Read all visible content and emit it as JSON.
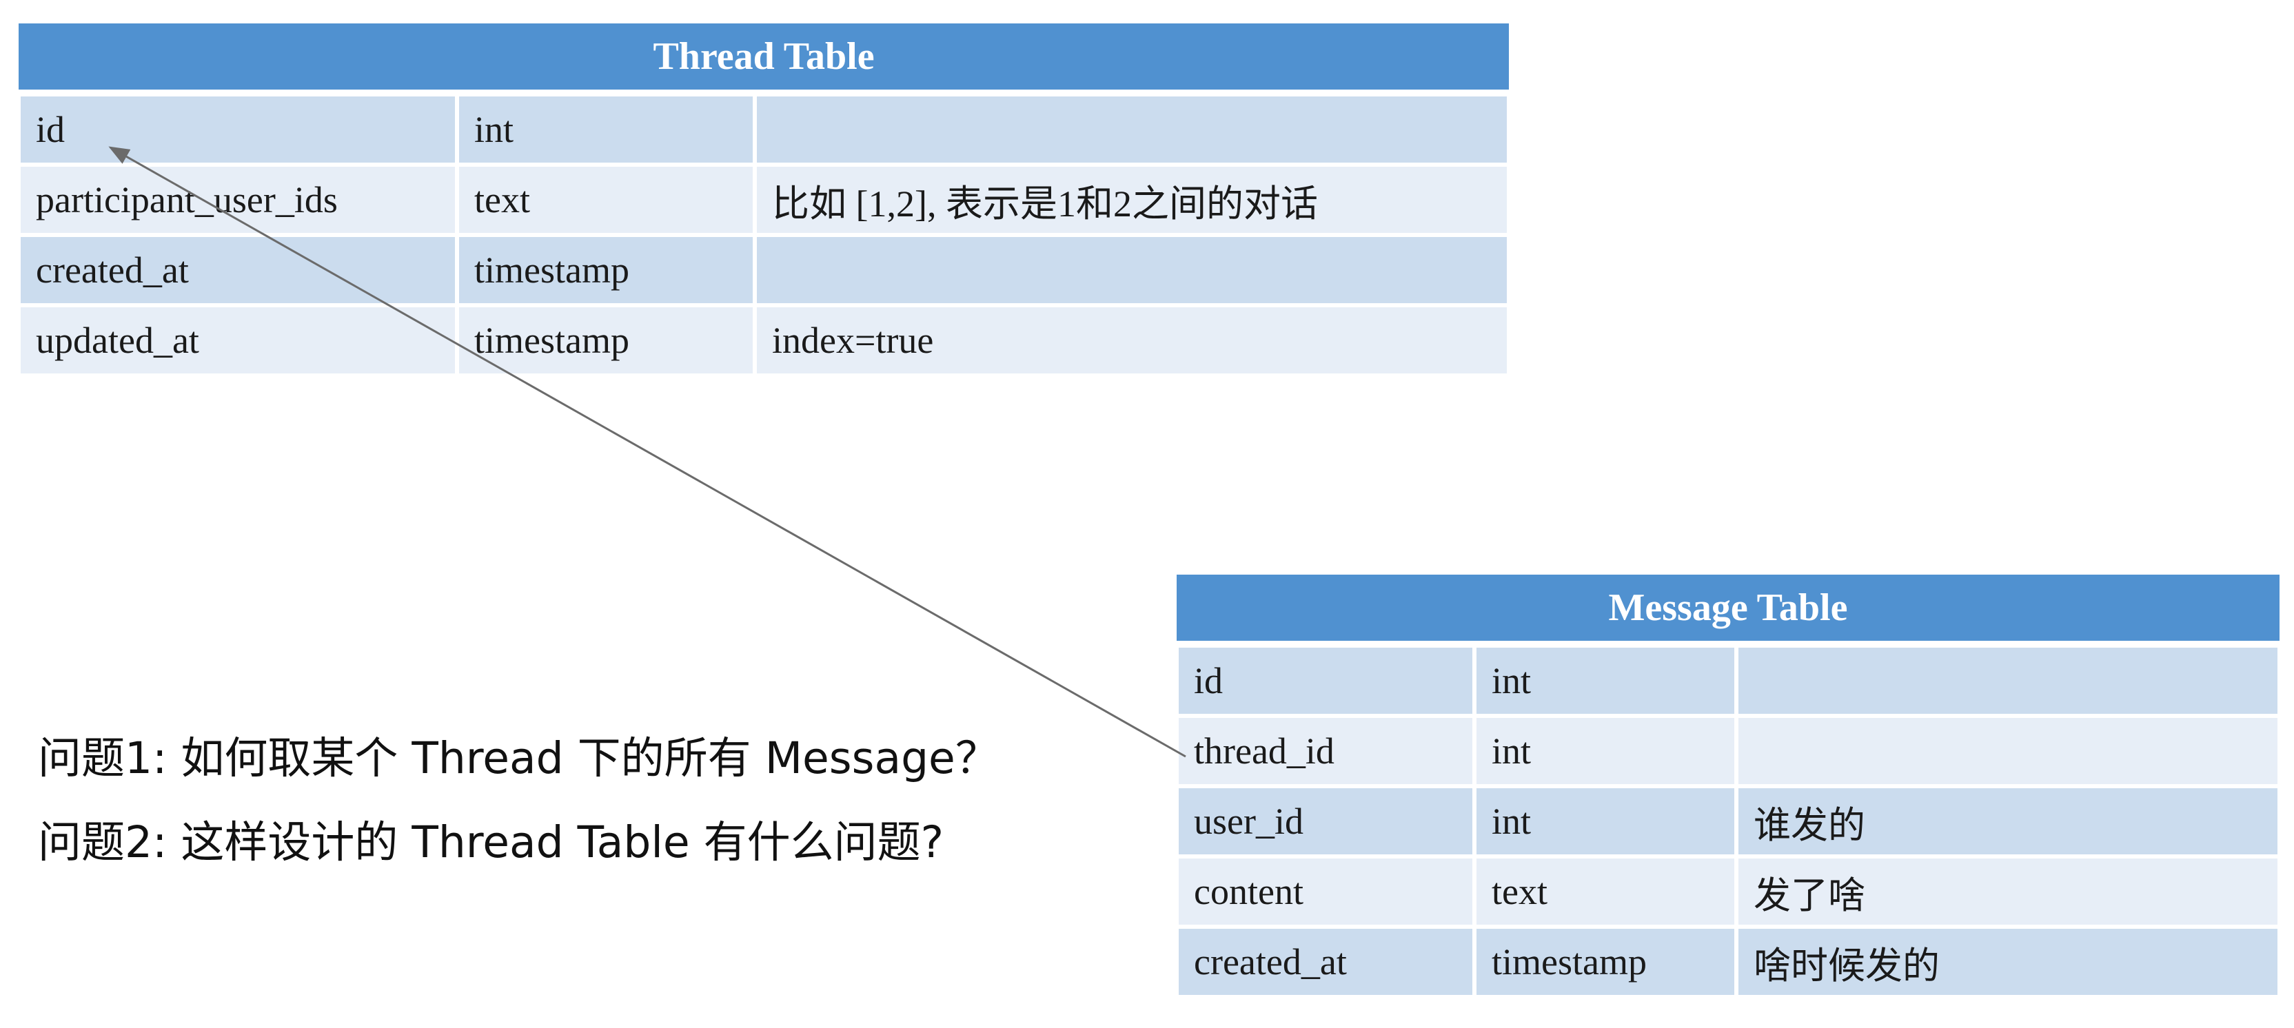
{
  "thread_table": {
    "title": "Thread Table",
    "rows": [
      {
        "name": "id",
        "type": "int",
        "note": ""
      },
      {
        "name": "participant_user_ids",
        "type": "text",
        "note": "比如 [1,2], 表示是1和2之间的对话"
      },
      {
        "name": "created_at",
        "type": "timestamp",
        "note": ""
      },
      {
        "name": "updated_at",
        "type": "timestamp",
        "note": "index=true"
      }
    ]
  },
  "message_table": {
    "title": "Message Table",
    "rows": [
      {
        "name": "id",
        "type": "int",
        "note": ""
      },
      {
        "name": "thread_id",
        "type": "int",
        "note": ""
      },
      {
        "name": "user_id",
        "type": "int",
        "note": "谁发的"
      },
      {
        "name": "content",
        "type": "text",
        "note": "发了啥"
      },
      {
        "name": "created_at",
        "type": "timestamp",
        "note": "啥时候发的"
      }
    ]
  },
  "questions": {
    "q1": "问题1: 如何取某个 Thread 下的所有 Message？",
    "q2": "问题2: 这样设计的 Thread Table 有什么问题?"
  },
  "colors": {
    "header": "#5091d0",
    "row_dark": "#cbdcee",
    "row_light": "#e7eef7",
    "arrow": "#6b6b6b"
  }
}
